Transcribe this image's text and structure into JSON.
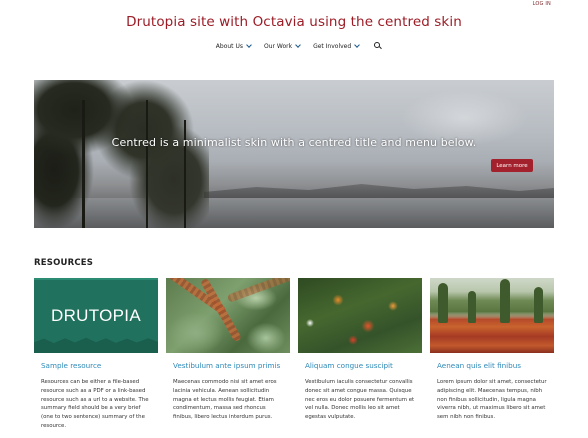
{
  "header": {
    "login_label": "LOG IN",
    "site_title": "Drutopia site with Octavia using the centred skin"
  },
  "nav": {
    "items": [
      {
        "label": "About Us"
      },
      {
        "label": "Our Work"
      },
      {
        "label": "Get Involved"
      }
    ],
    "search_icon": "search-icon"
  },
  "hero": {
    "caption": "Centred is a minimalist skin with a centred title and menu below.",
    "button_label": "Learn more"
  },
  "resources": {
    "heading": "RESOURCES",
    "cards": [
      {
        "image_text": "DRUTOPIA",
        "title": "Sample resource",
        "body": "Resources can be either a file-based resource such as a PDF or a link-based resource such as a url to a website. The summary field should be a very brief (one to two sentence) summary of the resource."
      },
      {
        "title": "Vestibulum ante ipsum primis",
        "body": "Maecenas commodo nisi sit amet eros lacinia vehicula. Aenean sollicitudin magna et lectus mollis feugiat. Etiam condimentum, massa sed rhoncus finibus, libero lectus interdum purus."
      },
      {
        "title": "Aliquam congue suscipit",
        "body": "Vestibulum iaculis consectetur convallis donec sit amet congue massa. Quisque nec eros eu dolor posuere fermentum et vel nulla. Donec mollis leo sit amet egestas vulputate."
      },
      {
        "title": "Aenean quis elit finibus",
        "body": "Lorem ipsum dolor sit amet, consectetur adipiscing elit. Maecenas tempus, nibh non finibus sollicitudin, ligula magna viverra nibh, ut maximus libero sit amet sem nibh non finibus."
      }
    ]
  },
  "colors": {
    "title_red": "#9b1c26",
    "button_red": "#a3212c",
    "link_blue": "#2e8ab8",
    "drutopia_green": "#20715e"
  }
}
